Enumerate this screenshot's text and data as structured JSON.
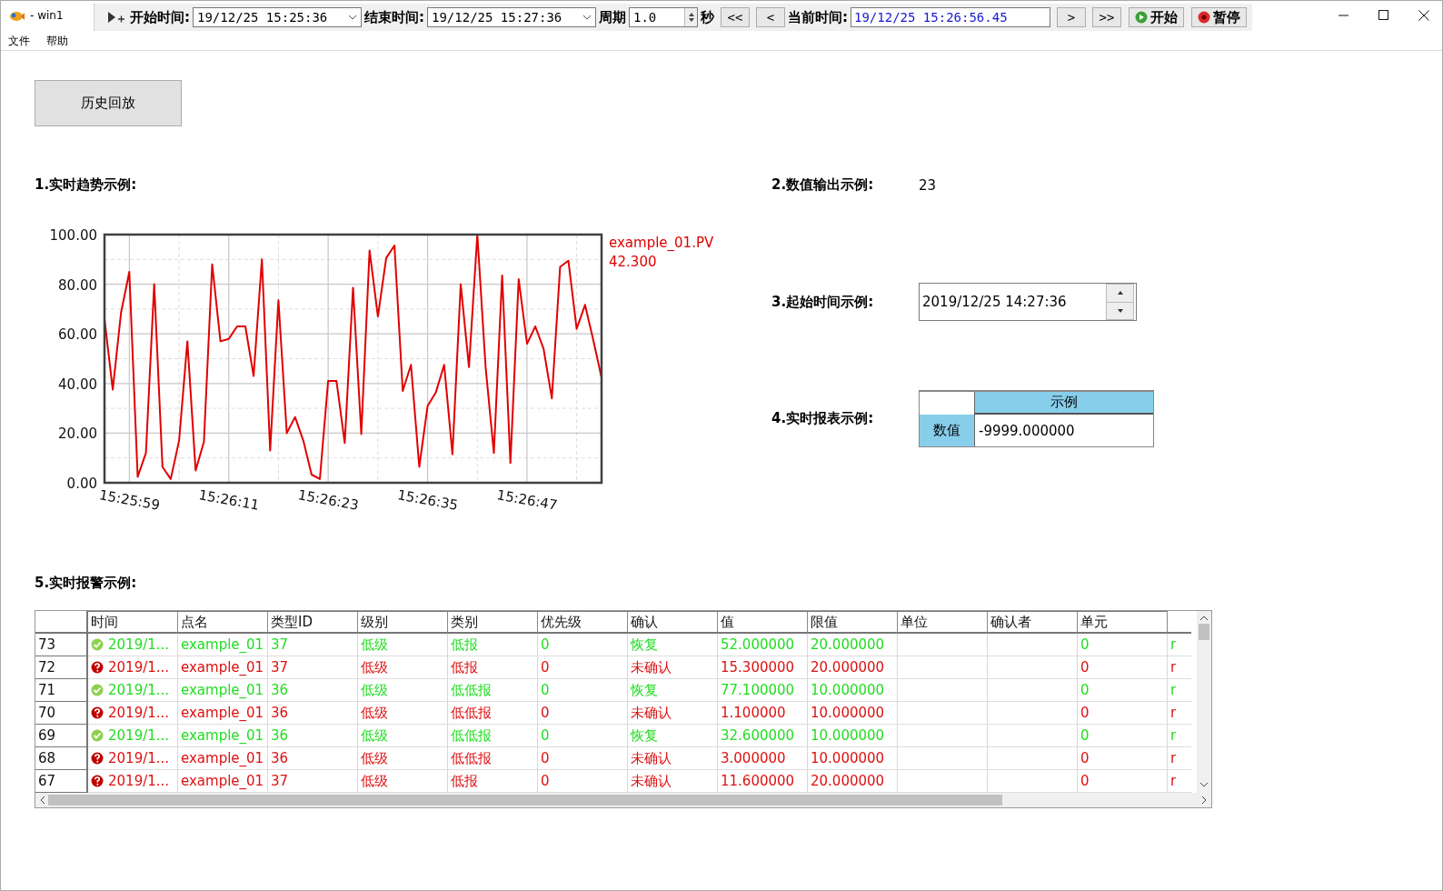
{
  "window": {
    "title": "- win1"
  },
  "menu": [
    "文件",
    "帮助"
  ],
  "toolbar": {
    "start_label": "开始时间:",
    "start_time": "19/12/25 15:25:36",
    "end_label": "结束时间:",
    "end_time": "19/12/25 15:27:36",
    "period_label": "周期",
    "period": "1.0",
    "period_unit": "秒",
    "back_buttons": [
      "<<",
      "<"
    ],
    "current_label": "当前时间:",
    "current_time": "19/12/25 15:26:56.45",
    "forward_buttons": [
      ">",
      ">>"
    ],
    "play_button": "开始",
    "pause_button": "暂停"
  },
  "history_button": "历史回放",
  "trend": {
    "heading": "1.实时趋势示例:",
    "legend_value": "42.300",
    "chart_data": {
      "type": "line",
      "categories": [
        null,
        null,
        null,
        "15:25:59",
        null,
        null,
        null,
        null,
        null,
        null,
        null,
        null,
        null,
        null,
        null,
        "15:26:11",
        null,
        null,
        null,
        null,
        null,
        null,
        null,
        null,
        null,
        null,
        null,
        "15:26:23",
        null,
        null,
        null,
        null,
        null,
        null,
        null,
        null,
        null,
        null,
        null,
        "15:26:35",
        null,
        null,
        null,
        null,
        null,
        null,
        null,
        null,
        null,
        null,
        null,
        "15:26:47",
        null,
        null,
        null,
        null,
        null,
        null,
        null,
        null,
        null
      ],
      "ylim": [
        0,
        100
      ],
      "grid": true,
      "series": [
        {
          "name": "example_01.PV",
          "color": "#e00000",
          "values": [
            66,
            37.5,
            68.5,
            85,
            2.4,
            12,
            80,
            6.4,
            1.5,
            17,
            57,
            5,
            16.5,
            88,
            57,
            58,
            63,
            63,
            43,
            90,
            13,
            73.5,
            20,
            26.5,
            17,
            3.3,
            1.5,
            41,
            41,
            16,
            78.6,
            19.6,
            93.6,
            67,
            90.5,
            95.6,
            37,
            47.5,
            6.4,
            31,
            36.5,
            47.5,
            11.5,
            80,
            46.6,
            100,
            46.6,
            12,
            83.5,
            8,
            82,
            56,
            63,
            54,
            34,
            87,
            89.5,
            62,
            71.7,
            57.5,
            42.3
          ]
        }
      ],
      "yticks": [
        {
          "value": 0,
          "label": "0.00"
        },
        {
          "value": 20,
          "label": "20.00"
        },
        {
          "value": 40,
          "label": "40.00"
        },
        {
          "value": 60,
          "label": "60.00"
        },
        {
          "value": 80,
          "label": "80.00"
        },
        {
          "value": 100,
          "label": "100.00"
        }
      ]
    }
  },
  "numeric": {
    "heading": "2.数值输出示例:",
    "value": "23"
  },
  "start_time": {
    "heading": "3.起始时间示例:",
    "value": "2019/12/25 14:27:36"
  },
  "report": {
    "heading": "4.实时报表示例:",
    "column": "示例",
    "row": "数值",
    "value": "-9999.000000"
  },
  "alarms": {
    "heading": "5.实时报警示例:",
    "columns": [
      "时间",
      "点名",
      "类型ID",
      "级别",
      "类别",
      "优先级",
      "确认",
      "值",
      "限值",
      "单位",
      "确认者",
      "单元"
    ],
    "rows": [
      {
        "number": "73",
        "kind": "recovered",
        "cells": [
          "2019/1...",
          "example_01",
          "37",
          "低级",
          "低报",
          "0",
          "恢复",
          "52.000000",
          "20.000000",
          "",
          "",
          "0",
          "r"
        ]
      },
      {
        "number": "72",
        "kind": "unacknowledged",
        "cells": [
          "2019/1...",
          "example_01",
          "37",
          "低级",
          "低报",
          "0",
          "未确认",
          "15.300000",
          "20.000000",
          "",
          "",
          "0",
          "r"
        ]
      },
      {
        "number": "71",
        "kind": "recovered",
        "cells": [
          "2019/1...",
          "example_01",
          "36",
          "低级",
          "低低报",
          "0",
          "恢复",
          "77.100000",
          "10.000000",
          "",
          "",
          "0",
          "r"
        ]
      },
      {
        "number": "70",
        "kind": "unacknowledged",
        "cells": [
          "2019/1...",
          "example_01",
          "36",
          "低级",
          "低低报",
          "0",
          "未确认",
          "1.100000",
          "10.000000",
          "",
          "",
          "0",
          "r"
        ]
      },
      {
        "number": "69",
        "kind": "recovered",
        "cells": [
          "2019/1...",
          "example_01",
          "36",
          "低级",
          "低低报",
          "0",
          "恢复",
          "32.600000",
          "10.000000",
          "",
          "",
          "0",
          "r"
        ]
      },
      {
        "number": "68",
        "kind": "unacknowledged",
        "cells": [
          "2019/1...",
          "example_01",
          "36",
          "低级",
          "低低报",
          "0",
          "未确认",
          "3.000000",
          "10.000000",
          "",
          "",
          "0",
          "r"
        ]
      },
      {
        "number": "67",
        "kind": "unacknowledged",
        "cells": [
          "2019/1...",
          "example_01",
          "37",
          "低级",
          "低报",
          "0",
          "未确认",
          "11.600000",
          "20.000000",
          "",
          "",
          "0",
          "r"
        ]
      }
    ]
  }
}
